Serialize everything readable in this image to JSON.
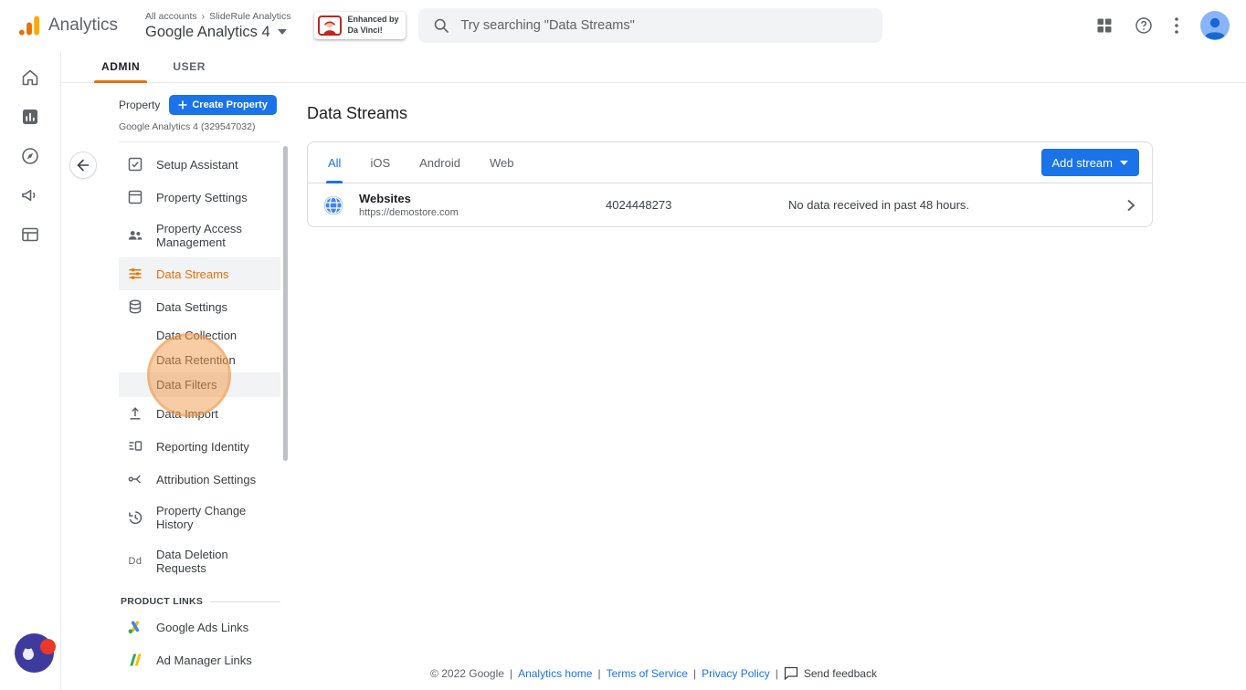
{
  "topbar": {
    "app_name": "Analytics",
    "breadcrumb": {
      "root": "All accounts",
      "separator": "›",
      "current": "SlideRule Analytics"
    },
    "property_selector": "Google Analytics 4",
    "enhanced_badge": {
      "line1": "Enhanced by",
      "line2": "Da Vinci!"
    },
    "search_placeholder": "Try searching \"Data Streams\""
  },
  "nav_tabs": {
    "admin": "ADMIN",
    "user": "USER"
  },
  "sidebar": {
    "section_label": "Property",
    "create_button_label": "Create Property",
    "property_name": "Google Analytics 4 (329547032)",
    "items": [
      {
        "label": "Setup Assistant"
      },
      {
        "label": "Property Settings"
      },
      {
        "label": "Property Access Management"
      },
      {
        "label": "Data Streams",
        "active": true
      },
      {
        "label": "Data Settings"
      },
      {
        "label": "Data Collection"
      },
      {
        "label": "Data Retention"
      },
      {
        "label": "Data Filters"
      },
      {
        "label": "Data Import"
      },
      {
        "label": "Reporting Identity"
      },
      {
        "label": "Attribution Settings"
      },
      {
        "label": "Property Change History"
      },
      {
        "label": "Data Deletion Requests",
        "icon_text": "Dd"
      }
    ],
    "product_links_header": "PRODUCT LINKS",
    "product_links": [
      {
        "label": "Google Ads Links"
      },
      {
        "label": "Ad Manager Links"
      }
    ]
  },
  "main": {
    "title": "Data Streams",
    "filter_tabs": [
      "All",
      "iOS",
      "Android",
      "Web"
    ],
    "active_filter_tab": "All",
    "add_stream_label": "Add stream",
    "streams": [
      {
        "name": "Websites",
        "url": "https://demostore.com",
        "stream_id": "4024448273",
        "status": "No data received in past 48 hours."
      }
    ]
  },
  "footer": {
    "copyright": "© 2022 Google",
    "separator": "|",
    "links": [
      "Analytics home",
      "Terms of Service",
      "Privacy Policy"
    ],
    "send_feedback": "Send feedback"
  },
  "colors": {
    "accent_blue": "#1a73e8",
    "active_orange": "#e8710a",
    "logo_orange": "#f9ab00",
    "highlight_circle": "rgba(242,153,74,0.5)"
  }
}
